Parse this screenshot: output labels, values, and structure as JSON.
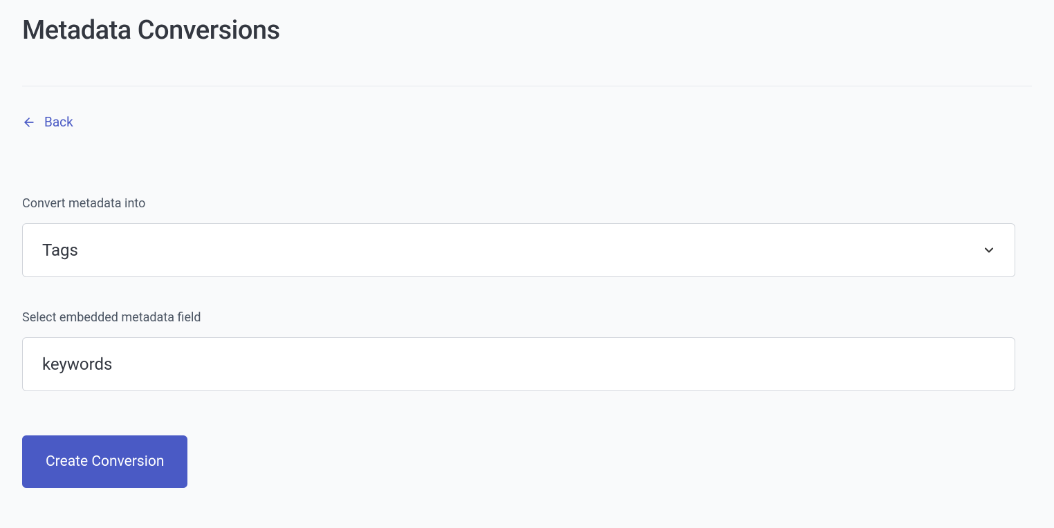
{
  "page": {
    "title": "Metadata Conversions"
  },
  "back_link": {
    "label": "Back"
  },
  "form": {
    "convert_into": {
      "label": "Convert metadata into",
      "value": "Tags"
    },
    "metadata_field": {
      "label": "Select embedded metadata field",
      "value": "keywords"
    },
    "submit_button": {
      "label": "Create Conversion"
    }
  }
}
